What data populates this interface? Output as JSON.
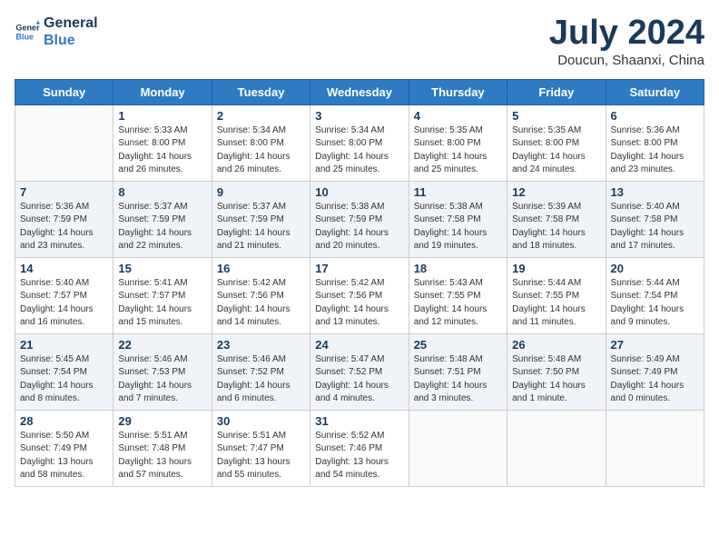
{
  "logo": {
    "line1": "General",
    "line2": "Blue"
  },
  "title": "July 2024",
  "location": "Doucun, Shaanxi, China",
  "weekdays": [
    "Sunday",
    "Monday",
    "Tuesday",
    "Wednesday",
    "Thursday",
    "Friday",
    "Saturday"
  ],
  "weeks": [
    [
      {
        "day": "",
        "info": ""
      },
      {
        "day": "1",
        "info": "Sunrise: 5:33 AM\nSunset: 8:00 PM\nDaylight: 14 hours\nand 26 minutes."
      },
      {
        "day": "2",
        "info": "Sunrise: 5:34 AM\nSunset: 8:00 PM\nDaylight: 14 hours\nand 26 minutes."
      },
      {
        "day": "3",
        "info": "Sunrise: 5:34 AM\nSunset: 8:00 PM\nDaylight: 14 hours\nand 25 minutes."
      },
      {
        "day": "4",
        "info": "Sunrise: 5:35 AM\nSunset: 8:00 PM\nDaylight: 14 hours\nand 25 minutes."
      },
      {
        "day": "5",
        "info": "Sunrise: 5:35 AM\nSunset: 8:00 PM\nDaylight: 14 hours\nand 24 minutes."
      },
      {
        "day": "6",
        "info": "Sunrise: 5:36 AM\nSunset: 8:00 PM\nDaylight: 14 hours\nand 23 minutes."
      }
    ],
    [
      {
        "day": "7",
        "info": "Sunrise: 5:36 AM\nSunset: 7:59 PM\nDaylight: 14 hours\nand 23 minutes."
      },
      {
        "day": "8",
        "info": "Sunrise: 5:37 AM\nSunset: 7:59 PM\nDaylight: 14 hours\nand 22 minutes."
      },
      {
        "day": "9",
        "info": "Sunrise: 5:37 AM\nSunset: 7:59 PM\nDaylight: 14 hours\nand 21 minutes."
      },
      {
        "day": "10",
        "info": "Sunrise: 5:38 AM\nSunset: 7:59 PM\nDaylight: 14 hours\nand 20 minutes."
      },
      {
        "day": "11",
        "info": "Sunrise: 5:38 AM\nSunset: 7:58 PM\nDaylight: 14 hours\nand 19 minutes."
      },
      {
        "day": "12",
        "info": "Sunrise: 5:39 AM\nSunset: 7:58 PM\nDaylight: 14 hours\nand 18 minutes."
      },
      {
        "day": "13",
        "info": "Sunrise: 5:40 AM\nSunset: 7:58 PM\nDaylight: 14 hours\nand 17 minutes."
      }
    ],
    [
      {
        "day": "14",
        "info": "Sunrise: 5:40 AM\nSunset: 7:57 PM\nDaylight: 14 hours\nand 16 minutes."
      },
      {
        "day": "15",
        "info": "Sunrise: 5:41 AM\nSunset: 7:57 PM\nDaylight: 14 hours\nand 15 minutes."
      },
      {
        "day": "16",
        "info": "Sunrise: 5:42 AM\nSunset: 7:56 PM\nDaylight: 14 hours\nand 14 minutes."
      },
      {
        "day": "17",
        "info": "Sunrise: 5:42 AM\nSunset: 7:56 PM\nDaylight: 14 hours\nand 13 minutes."
      },
      {
        "day": "18",
        "info": "Sunrise: 5:43 AM\nSunset: 7:55 PM\nDaylight: 14 hours\nand 12 minutes."
      },
      {
        "day": "19",
        "info": "Sunrise: 5:44 AM\nSunset: 7:55 PM\nDaylight: 14 hours\nand 11 minutes."
      },
      {
        "day": "20",
        "info": "Sunrise: 5:44 AM\nSunset: 7:54 PM\nDaylight: 14 hours\nand 9 minutes."
      }
    ],
    [
      {
        "day": "21",
        "info": "Sunrise: 5:45 AM\nSunset: 7:54 PM\nDaylight: 14 hours\nand 8 minutes."
      },
      {
        "day": "22",
        "info": "Sunrise: 5:46 AM\nSunset: 7:53 PM\nDaylight: 14 hours\nand 7 minutes."
      },
      {
        "day": "23",
        "info": "Sunrise: 5:46 AM\nSunset: 7:52 PM\nDaylight: 14 hours\nand 6 minutes."
      },
      {
        "day": "24",
        "info": "Sunrise: 5:47 AM\nSunset: 7:52 PM\nDaylight: 14 hours\nand 4 minutes."
      },
      {
        "day": "25",
        "info": "Sunrise: 5:48 AM\nSunset: 7:51 PM\nDaylight: 14 hours\nand 3 minutes."
      },
      {
        "day": "26",
        "info": "Sunrise: 5:48 AM\nSunset: 7:50 PM\nDaylight: 14 hours\nand 1 minute."
      },
      {
        "day": "27",
        "info": "Sunrise: 5:49 AM\nSunset: 7:49 PM\nDaylight: 14 hours\nand 0 minutes."
      }
    ],
    [
      {
        "day": "28",
        "info": "Sunrise: 5:50 AM\nSunset: 7:49 PM\nDaylight: 13 hours\nand 58 minutes."
      },
      {
        "day": "29",
        "info": "Sunrise: 5:51 AM\nSunset: 7:48 PM\nDaylight: 13 hours\nand 57 minutes."
      },
      {
        "day": "30",
        "info": "Sunrise: 5:51 AM\nSunset: 7:47 PM\nDaylight: 13 hours\nand 55 minutes."
      },
      {
        "day": "31",
        "info": "Sunrise: 5:52 AM\nSunset: 7:46 PM\nDaylight: 13 hours\nand 54 minutes."
      },
      {
        "day": "",
        "info": ""
      },
      {
        "day": "",
        "info": ""
      },
      {
        "day": "",
        "info": ""
      }
    ]
  ]
}
